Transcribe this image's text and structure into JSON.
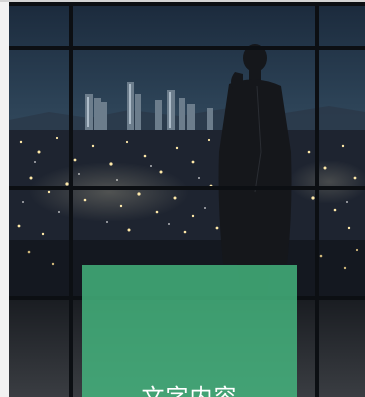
{
  "image": {
    "subject": "night-city-window-businessman"
  },
  "caption": {
    "text": "文字内容",
    "background_color": "#45b880",
    "text_color": "#ffffff"
  }
}
